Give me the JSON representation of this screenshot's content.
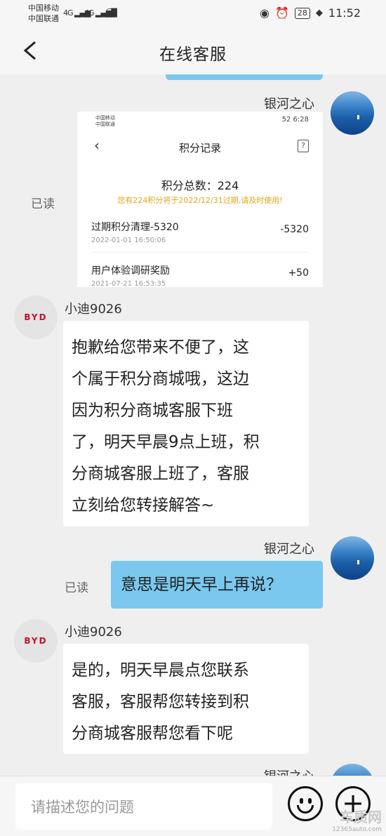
{
  "status": {
    "carrier1": "中国移动",
    "carrier2": "中国联通",
    "sig1": "4G",
    "sig2": "4G",
    "battery": "28",
    "time": "11:52"
  },
  "header": {
    "back_label": "<",
    "title": "在线客服"
  },
  "messages": {
    "m1": {
      "sender": "银河之心",
      "read": "已读",
      "screenshot": {
        "carrier1": "中国移动",
        "carrier2": "中国联通",
        "status_right": "52 6:28",
        "title": "积分记录",
        "help": "?",
        "total": "积分总数：224",
        "notice": "您有224积分将于2022/12/31过期,请及时使用!",
        "records": [
          {
            "name": "过期积分清理-5320",
            "date": "2022-01-01 16:50:06",
            "value": "-5320"
          },
          {
            "name": "用户体验调研奖励",
            "date": "2021-07-21 16:53:35",
            "value": "+50"
          }
        ]
      }
    },
    "m2": {
      "sender": "小迪9026",
      "text_lines": [
        "抱歉给您带来不便了，这",
        "个属于积分商城哦，这边",
        "因为积分商城客服下班",
        "了，明天早晨9点上班，积",
        "分商城客服上班了，客服",
        "立刻给您转接解答~"
      ]
    },
    "m3": {
      "sender": "银河之心",
      "read": "已读",
      "text": "意思是明天早上再说？"
    },
    "m4": {
      "sender": "小迪9026",
      "text_lines": [
        "是的，明天早晨点您联系",
        "客服，客服帮您转接到积",
        "分商城客服帮您看下呢"
      ]
    },
    "m5": {
      "sender": "银河之心"
    }
  },
  "input": {
    "placeholder": "请描述您的问题"
  },
  "byd_logo": "BYD",
  "watermark": {
    "line1": "车质网",
    "line2": "12365auto.com"
  },
  "colors": {
    "blue_bubble": "#7ac8ef",
    "notice": "#e6a41c",
    "byd_red": "#c8102e"
  }
}
